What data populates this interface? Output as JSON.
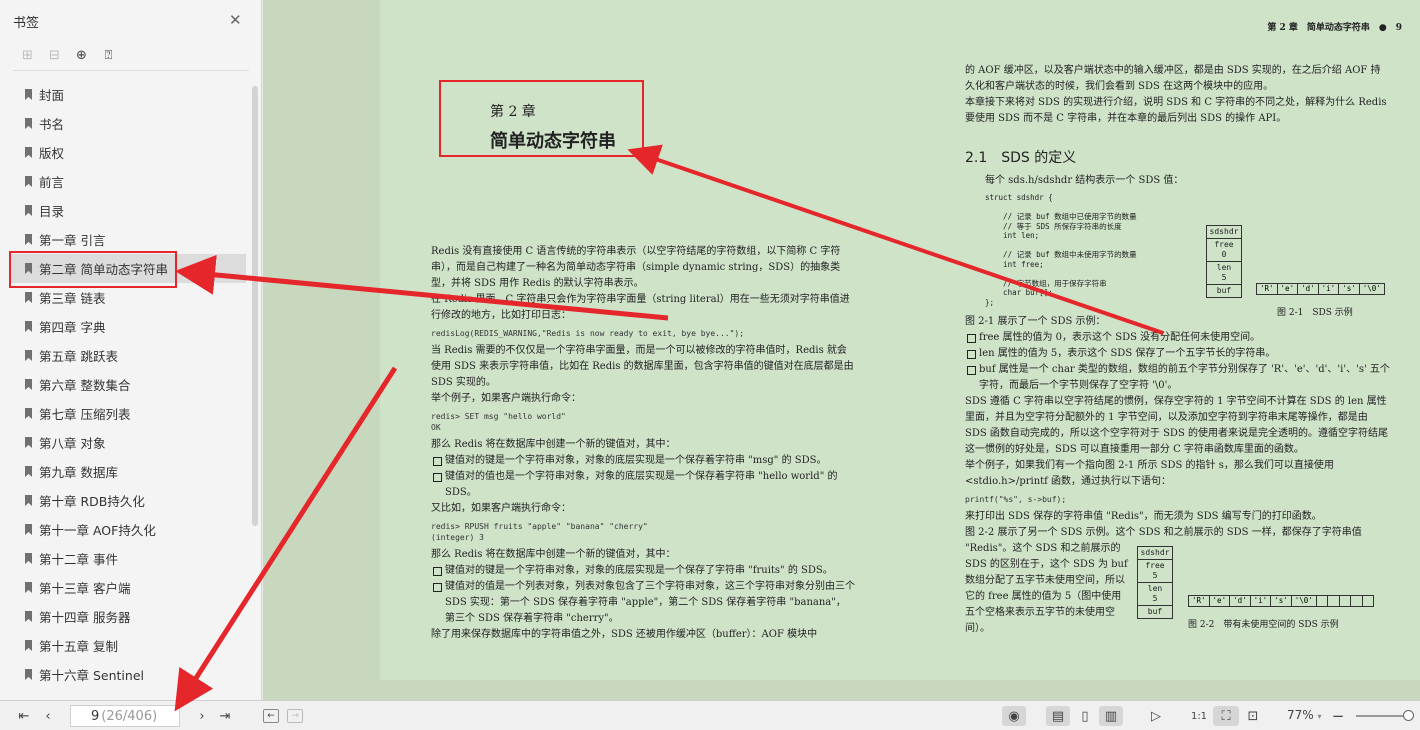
{
  "sidebar": {
    "title": "书签",
    "close_icon": "close-icon",
    "tools": [
      "expand-icon",
      "collapse-icon",
      "add-bookmark-icon",
      "bookmark-icon"
    ],
    "items": [
      {
        "label": "封面"
      },
      {
        "label": "书名"
      },
      {
        "label": "版权"
      },
      {
        "label": "前言"
      },
      {
        "label": "目录"
      },
      {
        "label": "第一章 引言"
      },
      {
        "label": "第二章 简单动态字符串"
      },
      {
        "label": "第三章 链表"
      },
      {
        "label": "第四章 字典"
      },
      {
        "label": "第五章 跳跃表"
      },
      {
        "label": "第六章 整数集合"
      },
      {
        "label": "第七章 压缩列表"
      },
      {
        "label": "第八章 对象"
      },
      {
        "label": "第九章 数据库"
      },
      {
        "label": "第十章 RDB持久化"
      },
      {
        "label": "第十一章 AOF持久化"
      },
      {
        "label": "第十二章 事件"
      },
      {
        "label": "第十三章 客户端"
      },
      {
        "label": "第十四章 服务器"
      },
      {
        "label": "第十五章 复制"
      },
      {
        "label": "第十六章 Sentinel"
      }
    ],
    "active_index": 6
  },
  "page": {
    "running_head": "第 2 章　简单动态字符串　●　9",
    "chapter_number": "第 2 章",
    "chapter_title": "简单动态字符串",
    "left_paragraphs": [
      "Redis 没有直接使用 C 语言传统的字符串表示（以空字符结尾的字符数组，以下简称 C 字符串），而是自己构建了一种名为简单动态字符串（simple dynamic string，SDS）的抽象类型，并将 SDS 用作 Redis 的默认字符串表示。",
      "在 Redis 里面，C 字符串只会作为字符串字面量（string literal）用在一些无须对字符串值进行修改的地方，比如打印日志：",
      "redisLog(REDIS_WARNING,\"Redis is now ready to exit, bye bye...\");",
      "当 Redis 需要的不仅仅是一个字符串字面量，而是一个可以被修改的字符串值时，Redis 就会使用 SDS 来表示字符串值，比如在 Redis 的数据库里面，包含字符串值的键值对在底层都是由 SDS 实现的。",
      "举个例子，如果客户端执行命令：",
      "redis> SET msg \"hello world\"\nOK",
      "那么 Redis 将在数据库中创建一个新的键值对，其中：",
      "键值对的键是一个字符串对象，对象的底层实现是一个保存着字符串 \"msg\" 的 SDS。",
      "键值对的值也是一个字符串对象，对象的底层实现是一个保存着字符串 \"hello world\" 的 SDS。",
      "又比如，如果客户端执行命令：",
      "redis> RPUSH fruits \"apple\" \"banana\" \"cherry\"\n(integer) 3",
      "那么 Redis 将在数据库中创建一个新的键值对，其中：",
      "键值对的键是一个字符串对象，对象的底层实现是一个保存了字符串 \"fruits\" 的 SDS。",
      "键值对的值是一个列表对象，列表对象包含了三个字符串对象，这三个字符串对象分别由三个 SDS 实现：第一个 SDS 保存着字符串 \"apple\"，第二个 SDS 保存着字符串 \"banana\"，第三个 SDS 保存着字符串 \"cherry\"。",
      "除了用来保存数据库中的字符串值之外，SDS 还被用作缓冲区（buffer）：AOF 模块中"
    ],
    "right_intro": [
      "的 AOF 缓冲区，以及客户端状态中的输入缓冲区，都是由 SDS 实现的，在之后介绍 AOF 持久化和客户端状态的时候，我们会看到 SDS 在这两个模块中的应用。",
      "本章接下来将对 SDS 的实现进行介绍，说明 SDS 和 C 字符串的不同之处，解释为什么 Redis 要使用 SDS 而不是 C 字符串，并在本章的最后列出 SDS 的操作 API。"
    ],
    "section_title": "2.1　SDS 的定义",
    "section_lead": "每个 sds.h/sdshdr 结构表示一个 SDS 值：",
    "struct_code": "struct sdshdr {\n\n    // 记录 buf 数组中已使用字节的数量\n    // 等于 SDS 所保存字符串的长度\n    int len;\n\n    // 记录 buf 数组中未使用字节的数量\n    int free;\n\n    // 字节数组，用于保存字符串\n    char buf[];\n};",
    "fig1": {
      "cells": [
        "sdshdr",
        "free\n0",
        "len\n5",
        "buf"
      ],
      "buf": [
        "'R'",
        "'e'",
        "'d'",
        "'i'",
        "'s'",
        "'\\0'"
      ],
      "caption": "图 2-1　SDS 示例"
    },
    "right_body": [
      "图 2-1 展示了一个 SDS 示例：",
      "free 属性的值为 0，表示这个 SDS 没有分配任何未使用空间。",
      "len 属性的值为 5，表示这个 SDS 保存了一个五字节长的字符串。",
      "buf 属性是一个 char 类型的数组，数组的前五个字节分别保存了 'R'、'e'、'd'、'i'、's' 五个字符，而最后一个字节则保存了空字符 '\\0'。",
      "SDS 遵循 C 字符串以空字符结尾的惯例，保存空字符的 1 字节空间不计算在 SDS 的 len 属性里面，并且为空字符分配额外的 1 字节空间，以及添加空字符到字符串末尾等操作，都是由 SDS 函数自动完成的，所以这个空字符对于 SDS 的使用者来说是完全透明的。遵循空字符结尾这一惯例的好处是，SDS 可以直接重用一部分 C 字符串函数库里面的函数。",
      "举个例子，如果我们有一个指向图 2-1 所示 SDS 的指针 s，那么我们可以直接使用 <stdio.h>/printf 函数，通过执行以下语句：",
      "printf(\"%s\", s->buf);",
      "来打印出 SDS 保存的字符串值 \"Redis\"，而无须为 SDS 编写专门的打印函数。",
      "图 2-2 展示了另一个 SDS 示例。这个 SDS 和之前展示的 SDS 一样，都保存了字符串值",
      "\"Redis\"。这个 SDS 和之前展示的 SDS 的区别在于，这个 SDS 为 buf 数组分配了五字节未使用空间，所以它的 free 属性的值为 5（图中使用五个空格来表示五字节的未使用空间）。"
    ],
    "fig2": {
      "cells": [
        "sdshdr",
        "free\n5",
        "len\n5",
        "buf"
      ],
      "buf": [
        "'R'",
        "'e'",
        "'d'",
        "'i'",
        "'s'",
        "'\\0'",
        " ",
        " ",
        " ",
        " ",
        " "
      ],
      "caption": "图 2-2　带有未使用空间的 SDS 示例"
    }
  },
  "bottom": {
    "page_current": "9",
    "page_total": "(26/406)",
    "zoom": "77%",
    "zoom_level": 0.77
  },
  "colors": {
    "annotation": "#e5262a",
    "page_bg": "#cfe3c9"
  }
}
